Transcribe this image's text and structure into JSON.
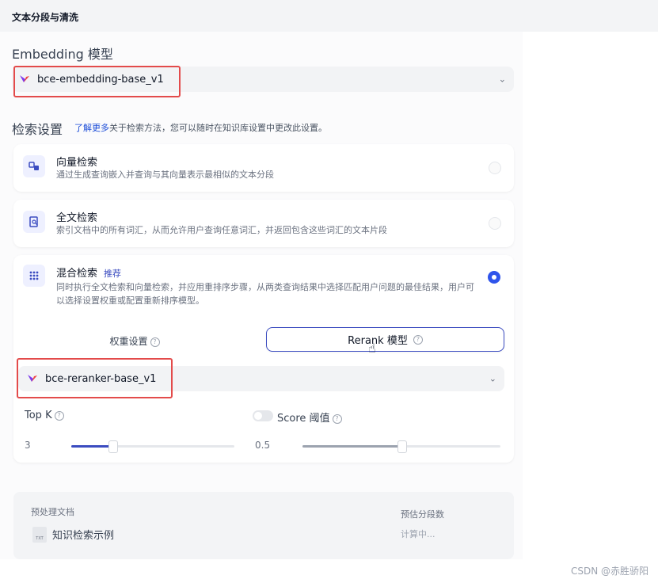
{
  "header": {
    "title": "文本分段与清洗"
  },
  "embedding": {
    "section_title": "Embedding 模型",
    "model_name": "bce-embedding-base_v1"
  },
  "retrieval": {
    "section_title": "检索设置",
    "hint_link": "了解更多",
    "hint_text": "关于检索方法，您可以随时在知识库设置中更改此设置。",
    "options": [
      {
        "title": "向量检索",
        "desc": "通过生成查询嵌入并查询与其向量表示最相似的文本分段",
        "selected": false
      },
      {
        "title": "全文检索",
        "desc": "索引文档中的所有词汇，从而允许用户查询任意词汇，并返回包含这些词汇的文本片段",
        "selected": false
      },
      {
        "title": "混合检索",
        "badge": "推荐",
        "desc": "同时执行全文检索和向量检索，并应用重排序步骤，从两类查询结果中选择匹配用户问题的最佳结果，用户可以选择设置权重或配置重新排序模型。",
        "selected": true
      }
    ],
    "tabs": {
      "weight": "权重设置",
      "rerank": "Rerank 模型"
    },
    "rerank_model": "bce-reranker-base_v1",
    "topk": {
      "label": "Top K",
      "value": "3",
      "fill_fraction": 0.25
    },
    "score": {
      "label": "Score 阈值",
      "value": "0.5",
      "enabled": false,
      "fill_fraction": 0.5
    }
  },
  "preview": {
    "doc_label": "预处理文档",
    "doc_name": "知识检索示例",
    "file_tag": "TXT",
    "estimate_label": "预估分段数",
    "estimate_value": "计算中..."
  },
  "watermark": "CSDN @赤胜骄阳",
  "colors": {
    "accent": "#3b4cc0",
    "highlight_box": "#e34b4b"
  }
}
